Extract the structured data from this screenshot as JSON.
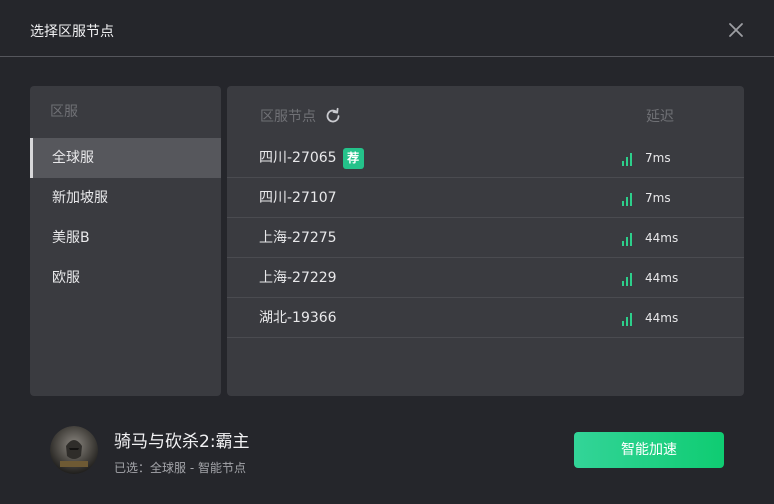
{
  "dialog": {
    "title": "选择区服节点",
    "close_icon": "close-icon"
  },
  "regions": {
    "header": "区服",
    "items": [
      {
        "label": "全球服",
        "active": true
      },
      {
        "label": "新加坡服",
        "active": false
      },
      {
        "label": "美服B",
        "active": false
      },
      {
        "label": "欧服",
        "active": false
      }
    ]
  },
  "nodes": {
    "header": "区服节点",
    "refresh_icon": "refresh-icon",
    "latency_header": "延迟",
    "recommend_badge": "荐",
    "signal_icon": "signal-bars-icon",
    "rows": [
      {
        "name": "四川-27065",
        "latency": "7ms",
        "recommended": true
      },
      {
        "name": "四川-27107",
        "latency": "7ms",
        "recommended": false
      },
      {
        "name": "上海-27275",
        "latency": "44ms",
        "recommended": false
      },
      {
        "name": "上海-27229",
        "latency": "44ms",
        "recommended": false
      },
      {
        "name": "湖北-19366",
        "latency": "44ms",
        "recommended": false
      }
    ]
  },
  "footer": {
    "game_title": "骑马与砍杀2:霸主",
    "selection": "已选：全球服 - 智能节点",
    "accelerate_button": "智能加速"
  },
  "colors": {
    "accent": "#1fcc82",
    "badge": "#24c28a",
    "background": "#25262b",
    "panel": "#3a3b40"
  }
}
